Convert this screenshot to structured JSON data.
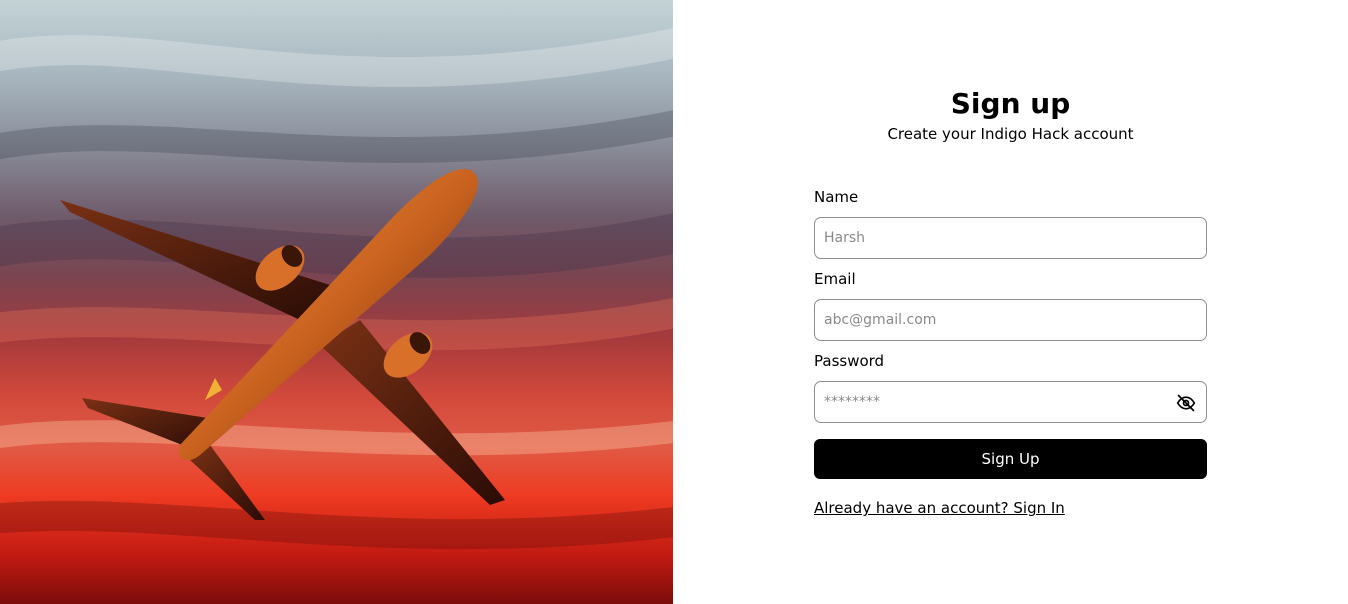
{
  "hero": {
    "image_icon": "airplane-in-sunset-sky"
  },
  "form": {
    "title": "Sign up",
    "subtitle": "Create your Indigo Hack account",
    "fields": [
      {
        "label": "Name",
        "placeholder": "Harsh",
        "value": ""
      },
      {
        "label": "Email",
        "placeholder": "abc@gmail.com",
        "value": ""
      },
      {
        "label": "Password",
        "placeholder": "********",
        "value": ""
      }
    ],
    "password_toggle_icon": "eye-off-icon",
    "submit_label": "Sign Up",
    "signin_link": "Already have an account? Sign In"
  },
  "colors": {
    "button_bg": "#000000",
    "button_text": "#ffffff",
    "input_border": "#8f8f8f"
  }
}
